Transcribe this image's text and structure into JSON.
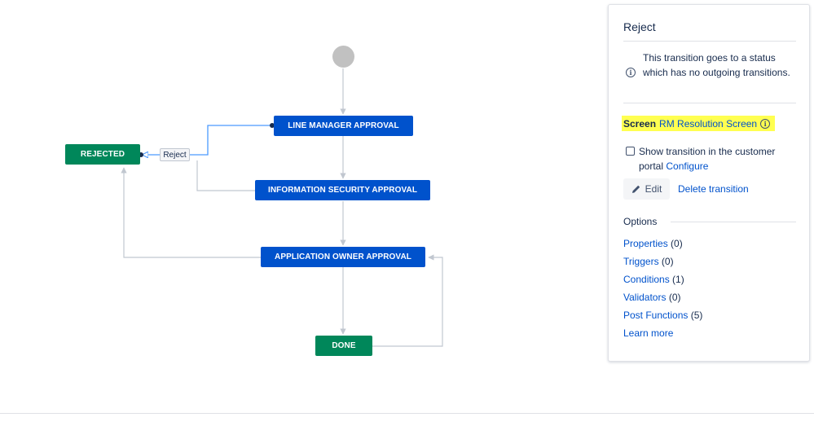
{
  "workflow": {
    "start_node": "start",
    "statuses": {
      "line_manager": "LINE MANAGER APPROVAL",
      "info_security": "INFORMATION SECURITY APPROVAL",
      "app_owner": "APPLICATION OWNER APPROVAL",
      "rejected": "REJECTED",
      "done": "DONE"
    },
    "selected_transition_label": "Reject",
    "colors": {
      "in_progress": "#0052cc",
      "done": "#00875a",
      "connector": "#c1c7d0",
      "selected_connector": "#4c9aff"
    }
  },
  "panel": {
    "title": "Reject",
    "notice": "This transition goes to a status which has no outgoing transitions.",
    "screen_label": "Screen",
    "screen_value": "RM Resolution Screen",
    "checkbox_label": "Show transition in the customer portal",
    "configure_link": "Configure",
    "edit_label": "Edit",
    "delete_label": "Delete transition",
    "options_title": "Options",
    "options": [
      {
        "label": "Properties",
        "count": "(0)"
      },
      {
        "label": "Triggers",
        "count": "(0)"
      },
      {
        "label": "Conditions",
        "count": "(1)"
      },
      {
        "label": "Validators",
        "count": "(0)"
      },
      {
        "label": "Post Functions",
        "count": "(5)"
      }
    ],
    "learn_more": "Learn more",
    "highlight_color": "#ffff50"
  }
}
